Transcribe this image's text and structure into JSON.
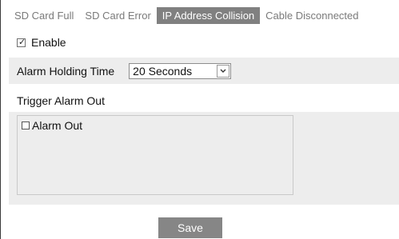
{
  "tabs": [
    {
      "label": "SD Card Full",
      "active": false
    },
    {
      "label": "SD Card Error",
      "active": false
    },
    {
      "label": "IP Address Collision",
      "active": true
    },
    {
      "label": "Cable Disconnected",
      "active": false
    }
  ],
  "enable": {
    "label": "Enable",
    "checked": true
  },
  "alarm_holding_time": {
    "label": "Alarm Holding Time",
    "selected": "20 Seconds"
  },
  "trigger_alarm_out": {
    "label": "Trigger Alarm Out",
    "items": [
      {
        "label": "Alarm Out",
        "checked": false
      }
    ]
  },
  "save_button": {
    "label": "Save"
  },
  "colors": {
    "active_tab_bg": "#808080",
    "inactive_tab_text": "#7a7a7a",
    "panel_bg": "#ededed",
    "save_button_bg": "#868686"
  }
}
